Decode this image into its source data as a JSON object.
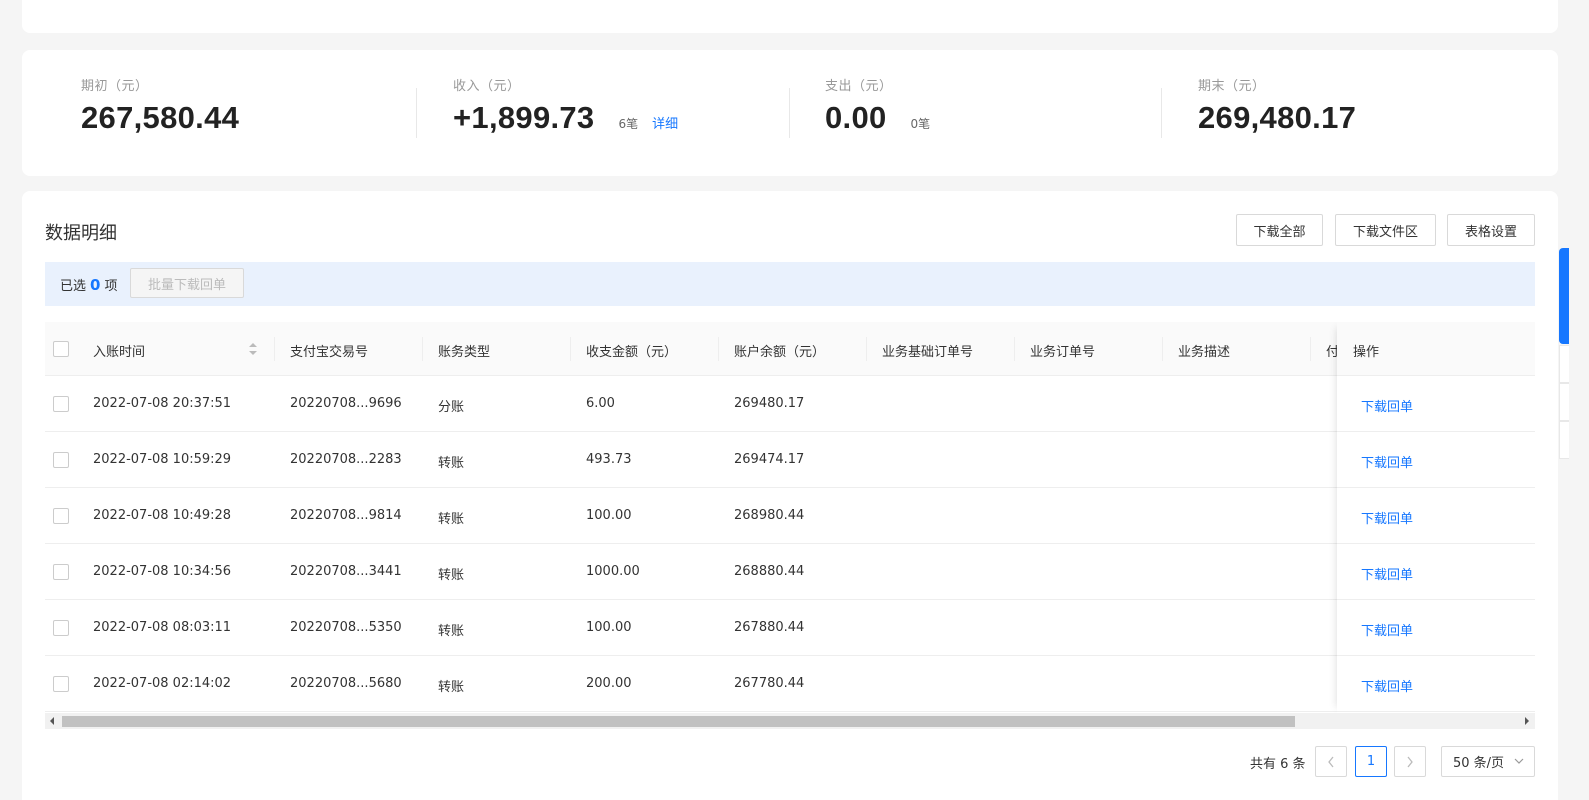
{
  "summary": {
    "opening": {
      "label": "期初（元）",
      "value": "267,580.44"
    },
    "income": {
      "label": "收入（元）",
      "value": "+1,899.73",
      "count": "6笔",
      "link": "详细"
    },
    "expense": {
      "label": "支出（元）",
      "value": "0.00",
      "count": "0笔"
    },
    "closing": {
      "label": "期末（元）",
      "value": "269,480.17"
    }
  },
  "detail": {
    "title": "数据明细",
    "buttons": {
      "download_all": "下载全部",
      "download_area": "下载文件区",
      "table_settings": "表格设置"
    },
    "selection": {
      "prefix": "已选",
      "count": "0",
      "suffix": "项",
      "batch_button": "批量下载回单"
    }
  },
  "table": {
    "columns": [
      "入账时间",
      "支付宝交易号",
      "账务类型",
      "收支金额（元）",
      "账户余额（元）",
      "业务基础订单号",
      "业务订单号",
      "业务描述",
      "付",
      "操作"
    ],
    "rows": [
      {
        "time": "2022-07-08 20:37:51",
        "trade_no": "20220708...9696",
        "type": "分账",
        "amount": "6.00",
        "balance": "269480.17",
        "action": "下载回单"
      },
      {
        "time": "2022-07-08 10:59:29",
        "trade_no": "20220708...2283",
        "type": "转账",
        "amount": "493.73",
        "balance": "269474.17",
        "action": "下载回单"
      },
      {
        "time": "2022-07-08 10:49:28",
        "trade_no": "20220708...9814",
        "type": "转账",
        "amount": "100.00",
        "balance": "268980.44",
        "action": "下载回单"
      },
      {
        "time": "2022-07-08 10:34:56",
        "trade_no": "20220708...3441",
        "type": "转账",
        "amount": "1000.00",
        "balance": "268880.44",
        "action": "下载回单"
      },
      {
        "time": "2022-07-08 08:03:11",
        "trade_no": "20220708...5350",
        "type": "转账",
        "amount": "100.00",
        "balance": "267880.44",
        "action": "下载回单"
      },
      {
        "time": "2022-07-08 02:14:02",
        "trade_no": "20220708...5680",
        "type": "转账",
        "amount": "200.00",
        "balance": "267780.44",
        "action": "下载回单"
      }
    ]
  },
  "pagination": {
    "total": "共有 6 条",
    "prev": "<",
    "current": "1",
    "next": ">",
    "page_size": "50 条/页"
  },
  "colors": {
    "accent": "#1677ff",
    "selection_bar": "#e9f1fd"
  }
}
